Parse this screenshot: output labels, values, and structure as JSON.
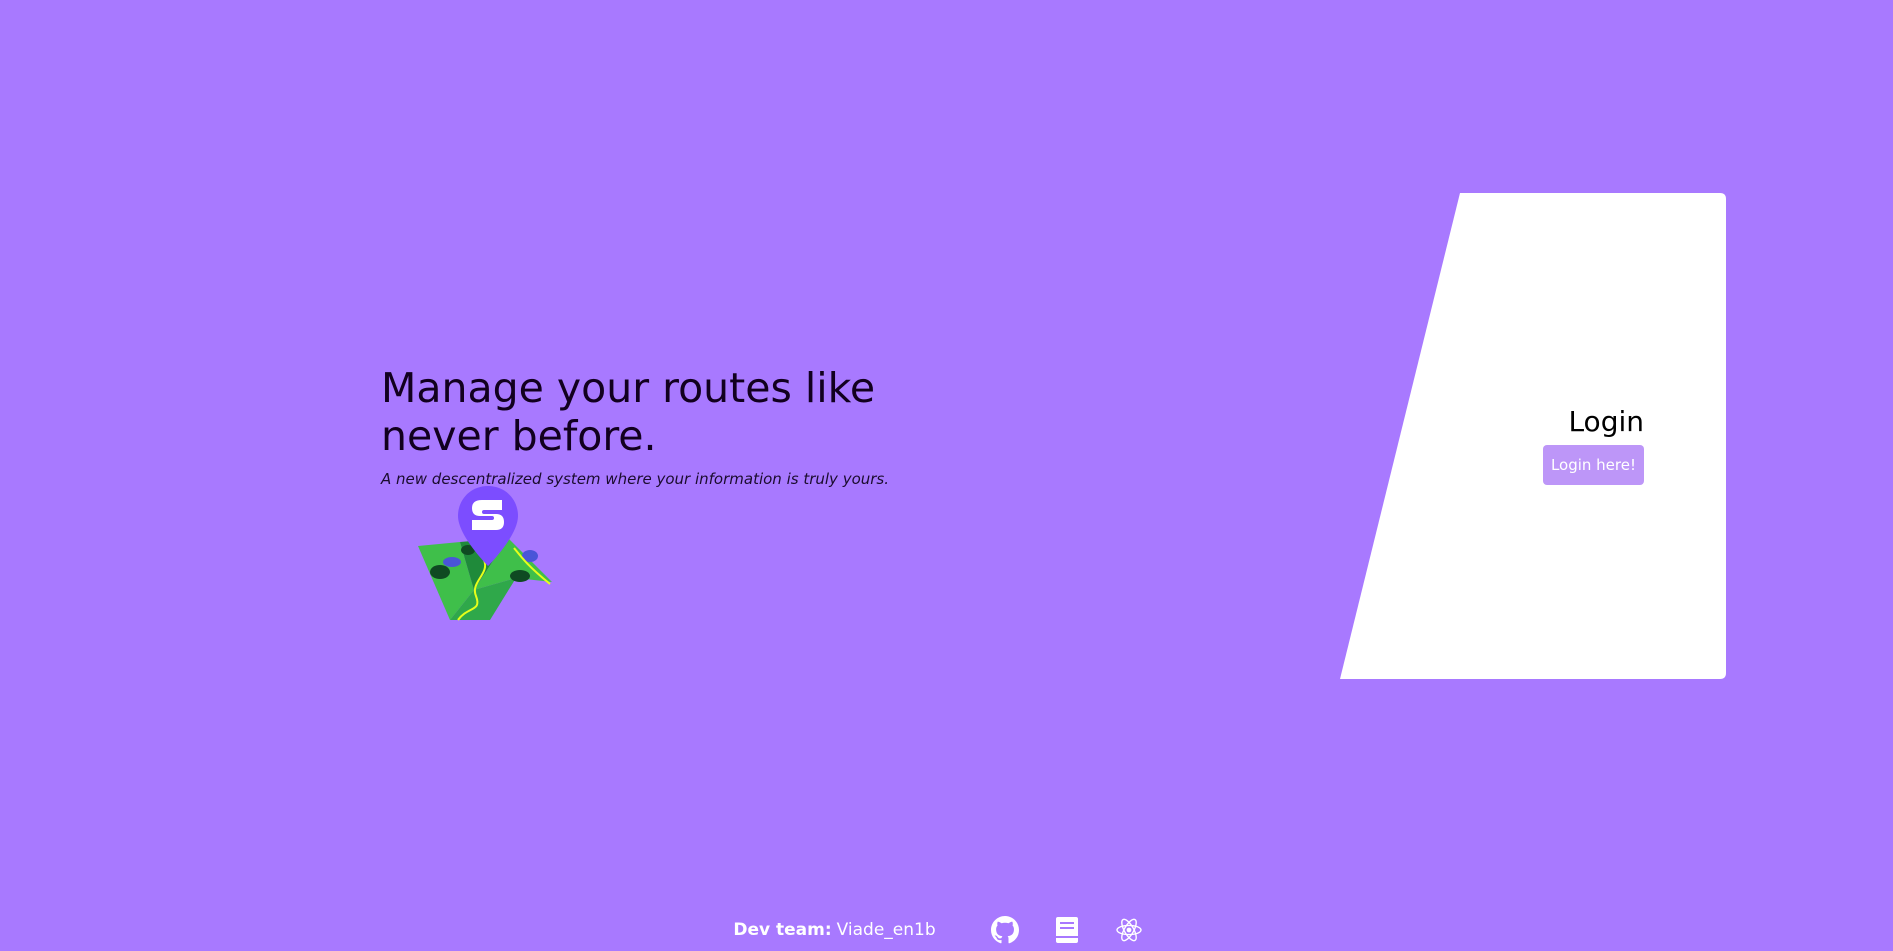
{
  "hero": {
    "title": "Manage your routes like never before.",
    "subtitle": "A new descentralized system where your information is truly yours."
  },
  "login": {
    "title": "Login",
    "button_label": "Login here!"
  },
  "footer": {
    "dev_team_label": "Dev team:",
    "dev_team_value": "Viade_en1b",
    "links": [
      {
        "icon": "github-icon"
      },
      {
        "icon": "book-icon"
      },
      {
        "icon": "react-icon"
      }
    ]
  },
  "colors": {
    "background": "#a879ff",
    "panel": "#ffffff",
    "button": "#bd96f8",
    "logo_pin": "#7c4dff",
    "logo_map_green": "#3fbf4a"
  }
}
